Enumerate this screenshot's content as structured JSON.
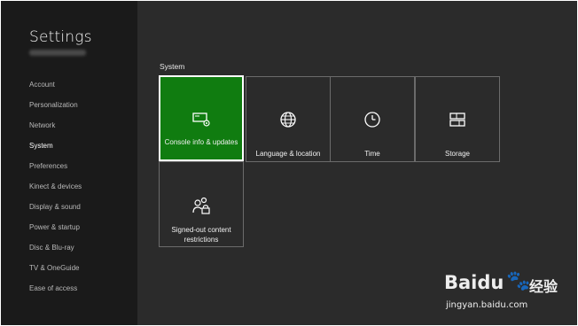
{
  "sidebar": {
    "title": "Settings",
    "items": [
      {
        "label": "Account"
      },
      {
        "label": "Personalization"
      },
      {
        "label": "Network"
      },
      {
        "label": "System"
      },
      {
        "label": "Preferences"
      },
      {
        "label": "Kinect & devices"
      },
      {
        "label": "Display & sound"
      },
      {
        "label": "Power & startup"
      },
      {
        "label": "Disc & Blu-ray"
      },
      {
        "label": "TV & OneGuide"
      },
      {
        "label": "Ease of access"
      }
    ],
    "selected": "System"
  },
  "main": {
    "section_title": "System",
    "tiles": [
      {
        "label": "Console info & updates",
        "icon": "console-icon",
        "selected": true
      },
      {
        "label": "Language & location",
        "icon": "globe-icon"
      },
      {
        "label": "Time",
        "icon": "clock-icon"
      },
      {
        "label": "Storage",
        "icon": "storage-icon"
      },
      {
        "label": "Signed-out content restrictions",
        "icon": "family-lock-icon"
      }
    ]
  },
  "watermark": {
    "brand": "Baidu",
    "suffix": "经验",
    "url": "jingyan.baidu.com"
  },
  "colors": {
    "accent": "#107c10",
    "background": "#2b2b2b",
    "sidebar": "#1a1a1a"
  }
}
